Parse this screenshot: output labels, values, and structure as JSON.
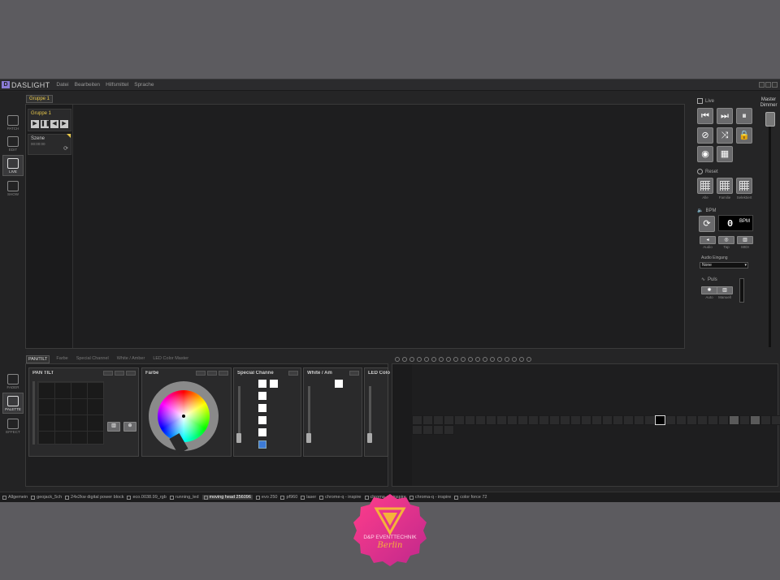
{
  "app": {
    "name": "DASLIGHT",
    "menu": [
      "Datei",
      "Bearbeiten",
      "Hilfsmittel",
      "Sprache"
    ]
  },
  "left_tools": [
    {
      "label": "PATCH"
    },
    {
      "label": "EDIT"
    },
    {
      "label": "LIVE",
      "active": true
    },
    {
      "label": "SHOW"
    }
  ],
  "bottom_tools": [
    {
      "label": "FADER"
    },
    {
      "label": "PALETTE",
      "active": true
    },
    {
      "label": "EFFECT"
    }
  ],
  "workspace": {
    "group_tab": "Gruppe 1",
    "group_card": {
      "name": "Gruppe 1"
    },
    "scene_card": {
      "name": "Szene",
      "time": "00:00:00"
    }
  },
  "live_panel": {
    "live_label": "Live",
    "reset_label": "Reset",
    "reset_buttons": [
      "Alle",
      "Familie",
      "Selektiert"
    ],
    "bpm_label": "BPM",
    "bpm_value": "0",
    "bpm_unit": "BPM",
    "bpm_buttons": [
      "Audio",
      "Tap",
      "MIDI"
    ],
    "audio_input_label": "Audio Eingang",
    "audio_input_value": "None",
    "puls_label": "Puls",
    "puls_buttons": [
      "Auto",
      "Manuell"
    ],
    "master_label": "Master Dimmer"
  },
  "palette_tabs": [
    "PAN/TILT",
    "Farbe",
    "Special Channel",
    "White / Amber",
    "LED Color Master"
  ],
  "palette_cards": {
    "pantilt": "PAN TILT",
    "farbe": "Farbe",
    "special": "Special Channe",
    "white": "White / Am",
    "led": "LED Colo"
  },
  "statusbar": [
    {
      "label": "Allgemein"
    },
    {
      "label": "geojack_5ch"
    },
    {
      "label": "24x2kw digital power block"
    },
    {
      "label": "eco.0038.99_rgb"
    },
    {
      "label": "running_led"
    },
    {
      "label": "moving head 256096",
      "active": true
    },
    {
      "label": "evo 250"
    },
    {
      "label": "pf960"
    },
    {
      "label": "laser"
    },
    {
      "label": "chrome-q - inspire"
    },
    {
      "label": "chroma-q - inspire"
    },
    {
      "label": "chroma-q - inspire"
    },
    {
      "label": "color force 72"
    }
  ],
  "watermark": {
    "text": "D&P EVENTTECHNIK",
    "city": "Berlin"
  },
  "colors": {
    "accent": "#e6c64a",
    "brand": "#8a7bd6",
    "blue": "#3d7bd6"
  }
}
